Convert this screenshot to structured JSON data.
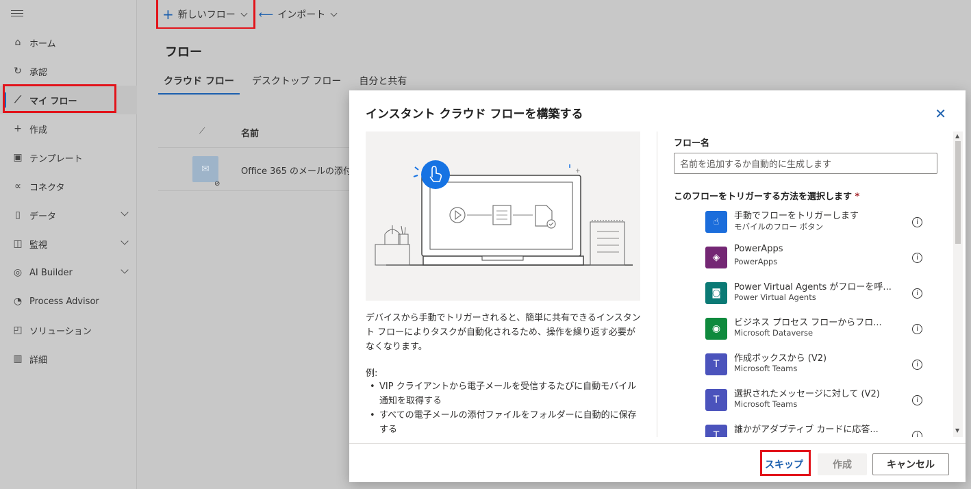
{
  "toolbar": {
    "new_flow": "新しいフロー",
    "import": "インポート"
  },
  "sidebar": {
    "items": [
      {
        "label": "ホーム",
        "icon": "home-icon"
      },
      {
        "label": "承認",
        "icon": "approval-icon"
      },
      {
        "label": "マイ フロー",
        "icon": "flow-icon",
        "active": true
      },
      {
        "label": "作成",
        "icon": "plus-icon"
      },
      {
        "label": "テンプレート",
        "icon": "template-icon"
      },
      {
        "label": "コネクタ",
        "icon": "connector-icon"
      },
      {
        "label": "データ",
        "icon": "data-icon",
        "expandable": true
      },
      {
        "label": "監視",
        "icon": "monitor-icon",
        "expandable": true
      },
      {
        "label": "AI Builder",
        "icon": "ai-builder-icon",
        "expandable": true
      },
      {
        "label": "Process Advisor",
        "icon": "process-advisor-icon"
      },
      {
        "label": "ソリューション",
        "icon": "solution-icon"
      },
      {
        "label": "詳細",
        "icon": "book-icon"
      }
    ]
  },
  "main": {
    "title": "フロー",
    "tabs": [
      "クラウド フロー",
      "デスクトップ フロー",
      "自分と共有"
    ],
    "table": {
      "col_name": "名前",
      "rows": [
        "Office 365 のメールの添付"
      ]
    }
  },
  "dialog": {
    "title": "インスタント クラウド フローを構築する",
    "description": "デバイスから手動でトリガーされると、簡単に共有できるインスタント フローによりタスクが自動化されるため、操作を繰り返す必要がなくなります。",
    "example_label": "例:",
    "examples": [
      "VIP クライアントから電子メールを受信するたびに自動モバイル通知を取得する",
      "すべての電子メールの添付ファイルをフォルダーに自動的に保存する"
    ],
    "flow_name_label": "フロー名",
    "flow_name_placeholder": "名前を追加するか自動的に生成します",
    "trigger_label": "このフローをトリガーする方法を選択します",
    "required_mark": "*",
    "triggers": [
      {
        "title": "手動でフローをトリガーします",
        "subtitle": "モバイルのフロー ボタン",
        "color": "#1b6ddb"
      },
      {
        "title": "PowerApps",
        "subtitle": "PowerApps",
        "color": "#742774"
      },
      {
        "title": "Power Virtual Agents がフローを呼...",
        "subtitle": "Power Virtual Agents",
        "color": "#0b7a75"
      },
      {
        "title": "ビジネス プロセス フローからフロ...",
        "subtitle": "Microsoft Dataverse",
        "color": "#0f8a3d"
      },
      {
        "title": "作成ボックスから (V2)",
        "subtitle": "Microsoft Teams",
        "color": "#4b53bc"
      },
      {
        "title": "選択されたメッセージに対して (V2)",
        "subtitle": "Microsoft Teams",
        "color": "#4b53bc"
      },
      {
        "title": "誰かがアダプティブ カードに応答...",
        "subtitle": "",
        "color": "#4b53bc"
      }
    ],
    "buttons": {
      "skip": "スキップ",
      "create": "作成",
      "cancel": "キャンセル"
    }
  },
  "accent_color": "#1b5fae",
  "highlight_color": "#e2141b"
}
